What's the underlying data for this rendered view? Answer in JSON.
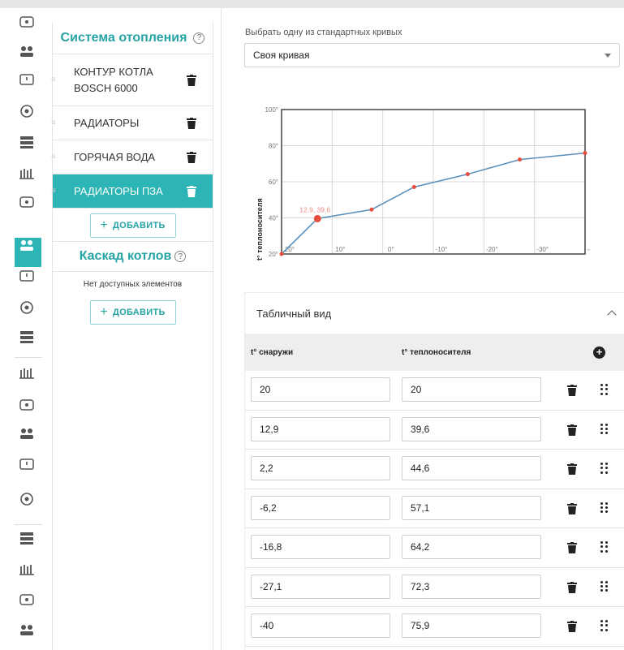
{
  "rail": {
    "icons": [
      "boiler-icon",
      "users-group-icon",
      "users-icon",
      "alert-icon",
      "gear-settings-icon",
      "sensor-settings-icon",
      "server-icon",
      "heating-icon",
      "fan-icon",
      "thermometer-icon",
      "network-icon",
      "wireless-icon",
      "relay-icon",
      "touch-icon",
      "control-panel-icon",
      "puzzle-icon",
      "antenna-icon",
      "remote-icon",
      "battery-icon",
      "cloud-icon"
    ],
    "active_index": 7
  },
  "heating": {
    "title": "Система отопления",
    "help": "?",
    "items": [
      {
        "label": "КОНТУР КОТЛА BOSCH 6000",
        "active": false
      },
      {
        "label": "РАДИАТОРЫ",
        "active": false
      },
      {
        "label": "ГОРЯЧАЯ ВОДА",
        "active": false
      },
      {
        "label": "РАДИАТОРЫ ПЗА",
        "active": true
      }
    ],
    "add_label": "ДОБАВИТЬ"
  },
  "cascade": {
    "title": "Каскад котлов",
    "help": "?",
    "empty_text": "Нет доступных элементов",
    "add_label": "ДОБАВИТЬ"
  },
  "curve": {
    "select_label": "Выбрать одну из стандартных кривых",
    "selected": "Своя кривая"
  },
  "chart_data": {
    "type": "line",
    "ylabel": "t° теплоносителя",
    "xlabel": "",
    "x": [
      20,
      12.9,
      2.2,
      -6.2,
      -16.8,
      -27.1,
      -40
    ],
    "y": [
      20,
      39.6,
      44.6,
      57.1,
      64.2,
      72.3,
      75.9
    ],
    "xticks": [
      "20°",
      "10°",
      "0°",
      "-10°",
      "-20°",
      "-30°",
      "-40°"
    ],
    "yticks": [
      "20°",
      "40°",
      "60°",
      "80°",
      "100°"
    ],
    "xlim": [
      20,
      -40
    ],
    "ylim": [
      20,
      100
    ],
    "highlight_label": "12.9, 39.6",
    "highlight_index": 1,
    "grid": true,
    "line_color": "#5b8fb9",
    "point_color": "#e74c3c"
  },
  "table": {
    "title": "Табличный вид",
    "col_outside": "t° снаружи",
    "col_coolant": "t° теплоносителя",
    "add_icon": "+",
    "rows": [
      {
        "outside": "20",
        "coolant": "20"
      },
      {
        "outside": "12,9",
        "coolant": "39,6"
      },
      {
        "outside": "2,2",
        "coolant": "44,6"
      },
      {
        "outside": "-6,2",
        "coolant": "57,1"
      },
      {
        "outside": "-16,8",
        "coolant": "64,2"
      },
      {
        "outside": "-27,1",
        "coolant": "72,3"
      },
      {
        "outside": "-40",
        "coolant": "75,9"
      }
    ]
  },
  "colors": {
    "accent": "#2cb5b4",
    "title": "#26a3a4"
  }
}
